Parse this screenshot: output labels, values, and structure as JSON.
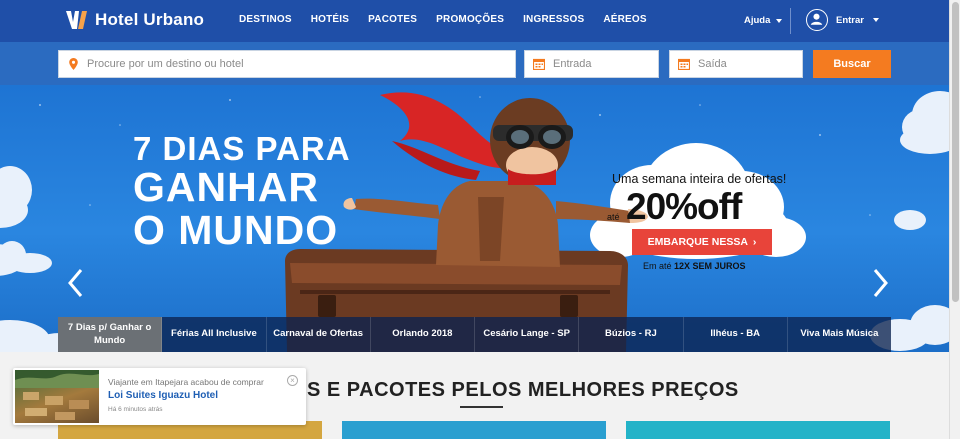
{
  "header": {
    "brand": "Hotel Urbano",
    "nav": [
      "DESTINOS",
      "HOTÉIS",
      "PACOTES",
      "PROMOÇÕES",
      "INGRESSOS",
      "AÉREOS"
    ],
    "help_label": "Ajuda",
    "login_label": "Entrar",
    "colors": {
      "header_bg": "#1f4fa8",
      "search_bg": "#2b6bc0",
      "accent": "#f47b20"
    }
  },
  "search": {
    "destination_placeholder": "Procure por um destino ou hotel",
    "checkin_placeholder": "Entrada",
    "checkout_placeholder": "Saída",
    "submit_label": "Buscar"
  },
  "hero": {
    "title_line1": "7 DIAS PARA",
    "title_line2": "GANHAR",
    "title_line3": "O MUNDO",
    "offer_subtitle": "Uma semana inteira de ofertas!",
    "offer_prefix": "até",
    "offer_value": "20%off",
    "cta_label": "EMBARQUE NESSA",
    "installments_prefix": "Em até",
    "installments_bold": "12X SEM JUROS",
    "tabs": [
      {
        "label": "7 Dias p/ Ganhar o Mundo",
        "active": true
      },
      {
        "label": "Férias All Inclusive"
      },
      {
        "label": "Carnaval de Ofertas"
      },
      {
        "label": "Orlando 2018"
      },
      {
        "label": "Cesário Lange - SP"
      },
      {
        "label": "Búzios - RJ"
      },
      {
        "label": "Ilhéus - BA"
      },
      {
        "label": "Viva Mais Música"
      }
    ]
  },
  "main": {
    "section_title_visible": "S E PACOTES PELOS MELHORES PREÇOS"
  },
  "notification": {
    "line1": "Viajante em Itapejara acabou de comprar",
    "hotel": "Loi Suites Iguazu Hotel",
    "time": "Há 6 minutos atrás"
  }
}
